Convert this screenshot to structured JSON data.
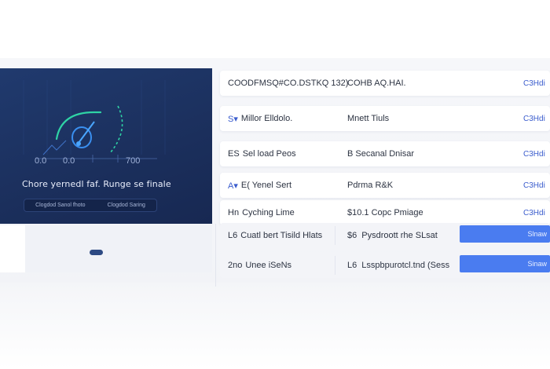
{
  "hero": {
    "title": "Chore yernedl faf. Runge se finale",
    "gauge_min": "0.0",
    "gauge_mid": "0.0",
    "gauge_max": "700",
    "pill_left": "Clogdod Sanol fhoto",
    "pill_right": "Clogdod Saring"
  },
  "rows": [
    {
      "col1": "COODFMSQ#CO.DSTKQ 132)",
      "col2": "COHB AQ.HAI.",
      "col3": "C3Hdi",
      "icon": ""
    },
    {
      "col1": "Millor Elldolo.",
      "col2": "Mnett Tiuls",
      "col3": "C3Hdi",
      "icon": "S▾"
    },
    {
      "col1": "Sel load Peos",
      "col2": "B Secanal Dnisar",
      "col3": "C3Hdi",
      "icon": "ES"
    },
    {
      "col1": "E( Yenel Sert",
      "col2": "Pdrma R&K",
      "col3": "C3Hdi",
      "icon": "A▾"
    },
    {
      "col1": "Cyching Lime",
      "col2": "$10.1 Copc Pmiage",
      "col3": "C3Hdi",
      "icon": "Hn"
    },
    {
      "col1": "Cuatl bert Tisild Hlats",
      "col2": "Pysdroott rhe SLsat",
      "col3": "",
      "icon": "L6",
      "col2_icon": "$6",
      "button": "Slnaw"
    },
    {
      "col1": "Unee iSeNs",
      "col2": "Lsspbpurotcl.tnd (Sess",
      "col3": "",
      "icon": "2no",
      "col2_icon": "L6",
      "button": "Sinaw"
    }
  ],
  "colors": {
    "accent": "#4a7cf0",
    "hero_bg": "#1d335f",
    "gauge": "#2fd3a5"
  }
}
